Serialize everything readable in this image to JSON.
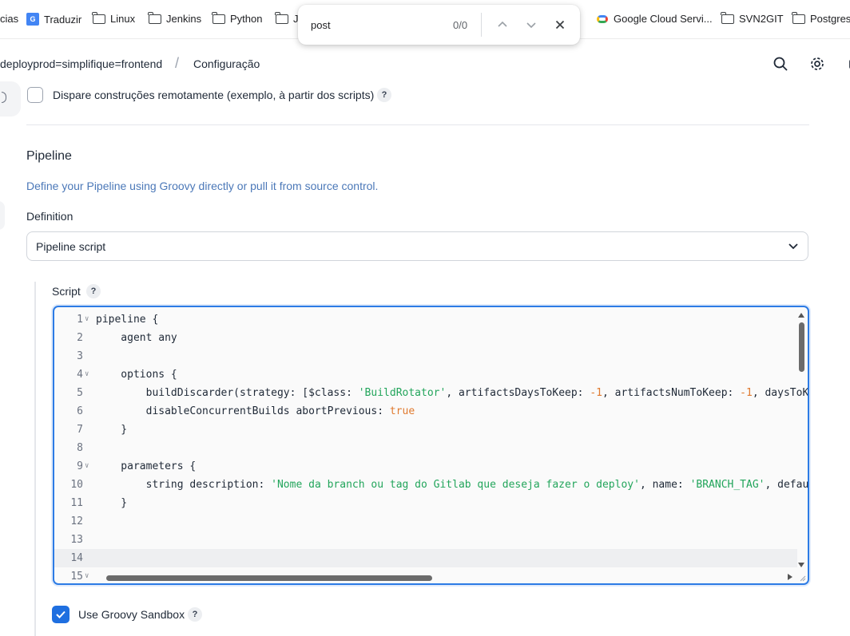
{
  "bookmarks": [
    {
      "label": "cias",
      "icon": "none"
    },
    {
      "label": "Traduzir",
      "icon": "google-translate-icon"
    },
    {
      "label": "Linux",
      "icon": "folder-icon"
    },
    {
      "label": "Jenkins",
      "icon": "folder-icon"
    },
    {
      "label": "Python",
      "icon": "folder-icon"
    },
    {
      "label": "J",
      "icon": "folder-icon"
    },
    {
      "label": "Google Cloud Servi...",
      "icon": "google-cloud-icon"
    },
    {
      "label": "SVN2GIT",
      "icon": "folder-icon"
    },
    {
      "label": "Postgresq",
      "icon": "folder-icon"
    }
  ],
  "find": {
    "query": "post",
    "count": "0/0"
  },
  "header": {
    "job": "deployprod=simplifique=frontend",
    "separator": "/",
    "page": "Configuração"
  },
  "trigger": {
    "label": "Dispare construções remotamente (exemplo, à partir dos scripts)",
    "help": "?"
  },
  "pipeline": {
    "title": "Pipeline",
    "description": "Define your Pipeline using Groovy directly or pull it from source control.",
    "definition_label": "Definition",
    "definition_value": "Pipeline script",
    "script_label": "Script",
    "script_help": "?"
  },
  "editor": {
    "lines": [
      {
        "n": "1",
        "fold": true,
        "segs": [
          {
            "t": "pipeline {",
            "c": ""
          }
        ]
      },
      {
        "n": "2",
        "fold": false,
        "segs": [
          {
            "t": "    agent any",
            "c": ""
          }
        ]
      },
      {
        "n": "3",
        "fold": false,
        "segs": [
          {
            "t": "",
            "c": ""
          }
        ]
      },
      {
        "n": "4",
        "fold": true,
        "segs": [
          {
            "t": "    options {",
            "c": ""
          }
        ]
      },
      {
        "n": "5",
        "fold": false,
        "segs": [
          {
            "t": "        buildDiscarder(strategy: [$class: ",
            "c": ""
          },
          {
            "t": "'BuildRotator'",
            "c": "tok-str"
          },
          {
            "t": ", artifactsDaysToKeep: ",
            "c": ""
          },
          {
            "t": "-1",
            "c": "tok-num"
          },
          {
            "t": ", artifactsNumToKeep: ",
            "c": ""
          },
          {
            "t": "-1",
            "c": "tok-num"
          },
          {
            "t": ", daysToK",
            "c": ""
          }
        ]
      },
      {
        "n": "6",
        "fold": false,
        "segs": [
          {
            "t": "        disableConcurrentBuilds abortPrevious: ",
            "c": ""
          },
          {
            "t": "true",
            "c": "tok-kw"
          }
        ]
      },
      {
        "n": "7",
        "fold": false,
        "segs": [
          {
            "t": "    }",
            "c": ""
          }
        ]
      },
      {
        "n": "8",
        "fold": false,
        "segs": [
          {
            "t": "",
            "c": ""
          }
        ]
      },
      {
        "n": "9",
        "fold": true,
        "segs": [
          {
            "t": "    parameters {",
            "c": ""
          }
        ]
      },
      {
        "n": "10",
        "fold": false,
        "segs": [
          {
            "t": "        string description: ",
            "c": ""
          },
          {
            "t": "'Nome da branch ou tag do Gitlab que deseja fazer o deploy'",
            "c": "tok-str"
          },
          {
            "t": ", name: ",
            "c": ""
          },
          {
            "t": "'BRANCH_TAG'",
            "c": "tok-str"
          },
          {
            "t": ", defau",
            "c": ""
          }
        ]
      },
      {
        "n": "11",
        "fold": false,
        "segs": [
          {
            "t": "    }",
            "c": ""
          }
        ]
      },
      {
        "n": "12",
        "fold": false,
        "segs": [
          {
            "t": "",
            "c": ""
          }
        ]
      },
      {
        "n": "13",
        "fold": false,
        "segs": [
          {
            "t": "",
            "c": ""
          }
        ]
      },
      {
        "n": "14",
        "fold": false,
        "segs": [
          {
            "t": "",
            "c": ""
          }
        ],
        "active": true
      },
      {
        "n": "15",
        "fold": true,
        "segs": [
          {
            "t": "",
            "c": ""
          }
        ]
      }
    ]
  },
  "sandbox": {
    "label": "Use Groovy Sandbox",
    "checked": true,
    "help": "?"
  },
  "colors": {
    "accent": "#1f6fe0",
    "editor_border": "#2c7be5",
    "string": "#22a55b",
    "number": "#e07a2f",
    "link": "#4b78b8"
  }
}
